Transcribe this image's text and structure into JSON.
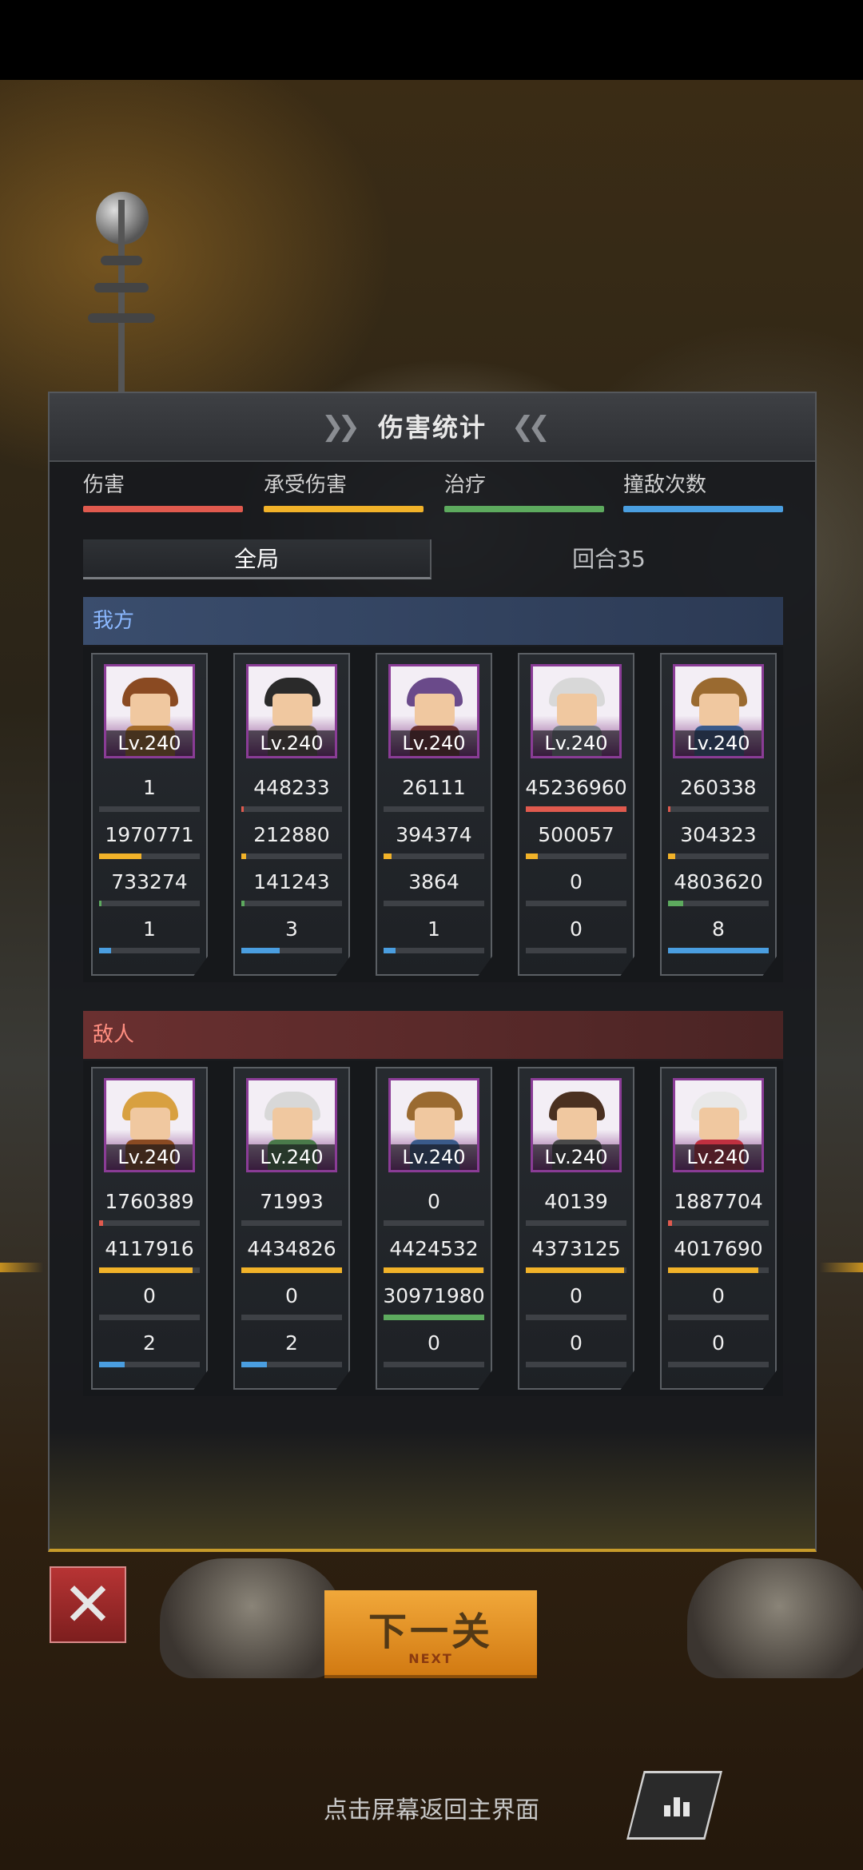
{
  "panel": {
    "title": "伤害统计",
    "legend": [
      {
        "label": "伤害",
        "color": "#e05a4e"
      },
      {
        "label": "承受伤害",
        "color": "#f1b229"
      },
      {
        "label": "治疗",
        "color": "#5daa5e"
      },
      {
        "label": "撞敌次数",
        "color": "#4a9ee0"
      }
    ],
    "tabs": [
      "全局",
      "回合35"
    ],
    "ally_label": "我方",
    "enemy_label": "敌人"
  },
  "allies": [
    {
      "level": "Lv.240",
      "damage": "1",
      "taken": "1970771",
      "heal": "733274",
      "hits": "1",
      "fills": [
        0.0,
        0.42,
        0.02,
        0.12
      ],
      "hair": "#8a4a22",
      "body": "#a36a2a"
    },
    {
      "level": "Lv.240",
      "damage": "448233",
      "taken": "212880",
      "heal": "141243",
      "hits": "3",
      "fills": [
        0.01,
        0.05,
        0.03,
        0.38
      ],
      "hair": "#2a2a2a",
      "body": "#5a4f45"
    },
    {
      "level": "Lv.240",
      "damage": "26111",
      "taken": "394374",
      "heal": "3864",
      "hits": "1",
      "fills": [
        0.0,
        0.08,
        0.0,
        0.12
      ],
      "hair": "#6a4a8a",
      "body": "#6a3030"
    },
    {
      "level": "Lv.240",
      "damage": "45236960",
      "taken": "500057",
      "heal": "0",
      "hits": "0",
      "fills": [
        1.0,
        0.12,
        0.0,
        0.0
      ],
      "hair": "#d8d8d8",
      "body": "#7a7f88"
    },
    {
      "level": "Lv.240",
      "damage": "260338",
      "taken": "304323",
      "heal": "4803620",
      "hits": "8",
      "fills": [
        0.01,
        0.07,
        0.15,
        1.0
      ],
      "hair": "#9a6a30",
      "body": "#3a5a8a"
    }
  ],
  "enemies": [
    {
      "level": "Lv.240",
      "damage": "1760389",
      "taken": "4117916",
      "heal": "0",
      "hits": "2",
      "fills": [
        0.04,
        0.93,
        0.0,
        0.25
      ],
      "hair": "#d8a040",
      "body": "#8a4a22"
    },
    {
      "level": "Lv.240",
      "damage": "71993",
      "taken": "4434826",
      "heal": "0",
      "hits": "2",
      "fills": [
        0.0,
        1.0,
        0.0,
        0.25
      ],
      "hair": "#d8d8d8",
      "body": "#4a7a4a"
    },
    {
      "level": "Lv.240",
      "damage": "0",
      "taken": "4424532",
      "heal": "30971980",
      "hits": "0",
      "fills": [
        0.0,
        0.99,
        1.0,
        0.0
      ],
      "hair": "#9a6a30",
      "body": "#3a5a8a"
    },
    {
      "level": "Lv.240",
      "damage": "40139",
      "taken": "4373125",
      "heal": "0",
      "hits": "0",
      "fills": [
        0.0,
        0.98,
        0.0,
        0.0
      ],
      "hair": "#4a3020",
      "body": "#4a4a4a"
    },
    {
      "level": "Lv.240",
      "damage": "1887704",
      "taken": "4017690",
      "heal": "0",
      "hits": "0",
      "fills": [
        0.04,
        0.9,
        0.0,
        0.0
      ],
      "hair": "#e8e8e8",
      "body": "#c03040"
    }
  ],
  "buttons": {
    "close_icon": "close-icon",
    "next_label": "下一关",
    "next_sub": "NEXT",
    "stats_icon": "bar-chart-icon"
  },
  "footer": {
    "hint": "点击屏幕返回主界面"
  }
}
